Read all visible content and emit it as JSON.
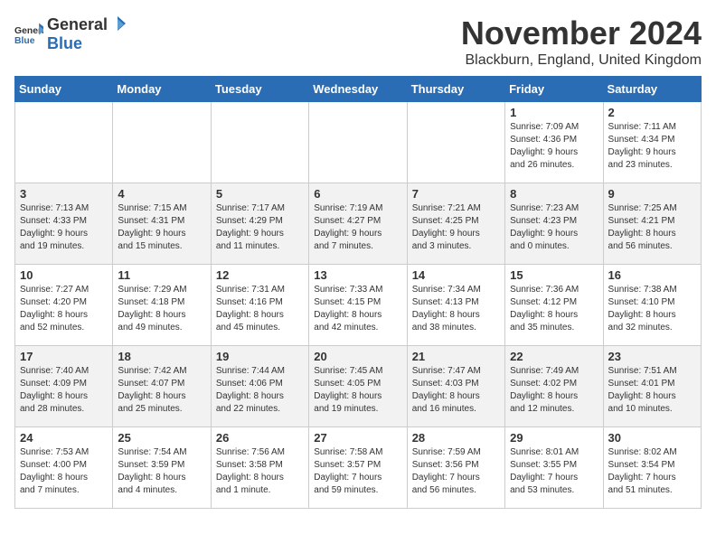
{
  "logo": {
    "text_general": "General",
    "text_blue": "Blue"
  },
  "header": {
    "title": "November 2024",
    "subtitle": "Blackburn, England, United Kingdom"
  },
  "weekdays": [
    "Sunday",
    "Monday",
    "Tuesday",
    "Wednesday",
    "Thursday",
    "Friday",
    "Saturday"
  ],
  "weeks": [
    [
      {
        "day": "",
        "info": ""
      },
      {
        "day": "",
        "info": ""
      },
      {
        "day": "",
        "info": ""
      },
      {
        "day": "",
        "info": ""
      },
      {
        "day": "",
        "info": ""
      },
      {
        "day": "1",
        "info": "Sunrise: 7:09 AM\nSunset: 4:36 PM\nDaylight: 9 hours\nand 26 minutes."
      },
      {
        "day": "2",
        "info": "Sunrise: 7:11 AM\nSunset: 4:34 PM\nDaylight: 9 hours\nand 23 minutes."
      }
    ],
    [
      {
        "day": "3",
        "info": "Sunrise: 7:13 AM\nSunset: 4:33 PM\nDaylight: 9 hours\nand 19 minutes."
      },
      {
        "day": "4",
        "info": "Sunrise: 7:15 AM\nSunset: 4:31 PM\nDaylight: 9 hours\nand 15 minutes."
      },
      {
        "day": "5",
        "info": "Sunrise: 7:17 AM\nSunset: 4:29 PM\nDaylight: 9 hours\nand 11 minutes."
      },
      {
        "day": "6",
        "info": "Sunrise: 7:19 AM\nSunset: 4:27 PM\nDaylight: 9 hours\nand 7 minutes."
      },
      {
        "day": "7",
        "info": "Sunrise: 7:21 AM\nSunset: 4:25 PM\nDaylight: 9 hours\nand 3 minutes."
      },
      {
        "day": "8",
        "info": "Sunrise: 7:23 AM\nSunset: 4:23 PM\nDaylight: 9 hours\nand 0 minutes."
      },
      {
        "day": "9",
        "info": "Sunrise: 7:25 AM\nSunset: 4:21 PM\nDaylight: 8 hours\nand 56 minutes."
      }
    ],
    [
      {
        "day": "10",
        "info": "Sunrise: 7:27 AM\nSunset: 4:20 PM\nDaylight: 8 hours\nand 52 minutes."
      },
      {
        "day": "11",
        "info": "Sunrise: 7:29 AM\nSunset: 4:18 PM\nDaylight: 8 hours\nand 49 minutes."
      },
      {
        "day": "12",
        "info": "Sunrise: 7:31 AM\nSunset: 4:16 PM\nDaylight: 8 hours\nand 45 minutes."
      },
      {
        "day": "13",
        "info": "Sunrise: 7:33 AM\nSunset: 4:15 PM\nDaylight: 8 hours\nand 42 minutes."
      },
      {
        "day": "14",
        "info": "Sunrise: 7:34 AM\nSunset: 4:13 PM\nDaylight: 8 hours\nand 38 minutes."
      },
      {
        "day": "15",
        "info": "Sunrise: 7:36 AM\nSunset: 4:12 PM\nDaylight: 8 hours\nand 35 minutes."
      },
      {
        "day": "16",
        "info": "Sunrise: 7:38 AM\nSunset: 4:10 PM\nDaylight: 8 hours\nand 32 minutes."
      }
    ],
    [
      {
        "day": "17",
        "info": "Sunrise: 7:40 AM\nSunset: 4:09 PM\nDaylight: 8 hours\nand 28 minutes."
      },
      {
        "day": "18",
        "info": "Sunrise: 7:42 AM\nSunset: 4:07 PM\nDaylight: 8 hours\nand 25 minutes."
      },
      {
        "day": "19",
        "info": "Sunrise: 7:44 AM\nSunset: 4:06 PM\nDaylight: 8 hours\nand 22 minutes."
      },
      {
        "day": "20",
        "info": "Sunrise: 7:45 AM\nSunset: 4:05 PM\nDaylight: 8 hours\nand 19 minutes."
      },
      {
        "day": "21",
        "info": "Sunrise: 7:47 AM\nSunset: 4:03 PM\nDaylight: 8 hours\nand 16 minutes."
      },
      {
        "day": "22",
        "info": "Sunrise: 7:49 AM\nSunset: 4:02 PM\nDaylight: 8 hours\nand 12 minutes."
      },
      {
        "day": "23",
        "info": "Sunrise: 7:51 AM\nSunset: 4:01 PM\nDaylight: 8 hours\nand 10 minutes."
      }
    ],
    [
      {
        "day": "24",
        "info": "Sunrise: 7:53 AM\nSunset: 4:00 PM\nDaylight: 8 hours\nand 7 minutes."
      },
      {
        "day": "25",
        "info": "Sunrise: 7:54 AM\nSunset: 3:59 PM\nDaylight: 8 hours\nand 4 minutes."
      },
      {
        "day": "26",
        "info": "Sunrise: 7:56 AM\nSunset: 3:58 PM\nDaylight: 8 hours\nand 1 minute."
      },
      {
        "day": "27",
        "info": "Sunrise: 7:58 AM\nSunset: 3:57 PM\nDaylight: 7 hours\nand 59 minutes."
      },
      {
        "day": "28",
        "info": "Sunrise: 7:59 AM\nSunset: 3:56 PM\nDaylight: 7 hours\nand 56 minutes."
      },
      {
        "day": "29",
        "info": "Sunrise: 8:01 AM\nSunset: 3:55 PM\nDaylight: 7 hours\nand 53 minutes."
      },
      {
        "day": "30",
        "info": "Sunrise: 8:02 AM\nSunset: 3:54 PM\nDaylight: 7 hours\nand 51 minutes."
      }
    ]
  ]
}
